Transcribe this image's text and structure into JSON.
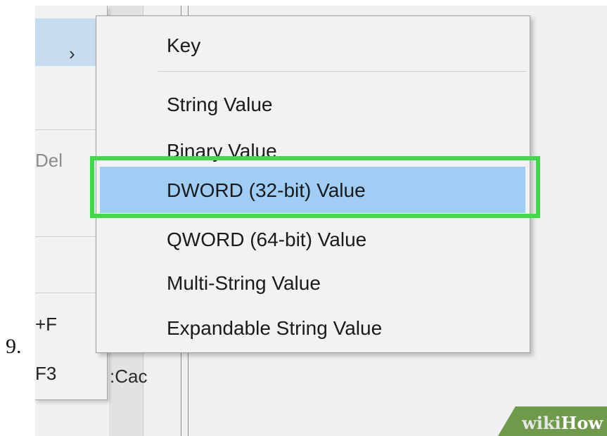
{
  "step_number": "9.",
  "background": {
    "text_fragment": ":Cac"
  },
  "parent_menu": {
    "chevron": "›",
    "items": [
      {
        "label": "Del",
        "disabled": true
      },
      {
        "label": "+F"
      },
      {
        "label": "F3"
      }
    ]
  },
  "submenu": {
    "items": [
      {
        "label": "Key"
      },
      {
        "label": "String Value"
      },
      {
        "label": "Binary Value"
      },
      {
        "label": "DWORD (32-bit) Value",
        "highlighted": true
      },
      {
        "label": "QWORD (64-bit) Value"
      },
      {
        "label": "Multi-String Value"
      },
      {
        "label": "Expandable String Value"
      }
    ]
  },
  "colors": {
    "highlight": "#9fcdf4",
    "annotation_box": "#3fd94a",
    "watermark_bg": "#6f9a4c"
  },
  "watermark": {
    "wiki": "wiki",
    "how": "How"
  }
}
